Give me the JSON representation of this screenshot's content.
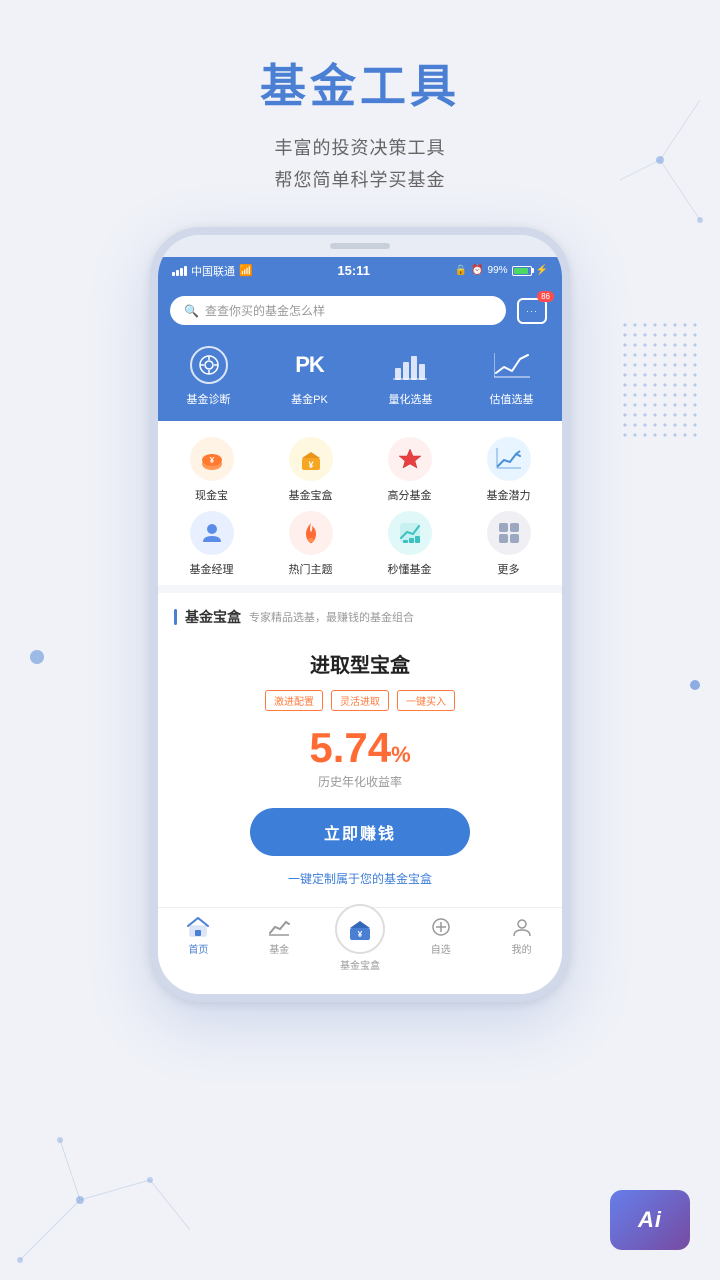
{
  "page": {
    "title": "基金工具",
    "subtitle_line1": "丰富的投资决策工具",
    "subtitle_line2": "帮您简单科学买基金"
  },
  "status_bar": {
    "carrier": "中国联通",
    "time": "15:11",
    "battery": "99%"
  },
  "search": {
    "placeholder": "查查你买的基金怎么样",
    "message_badge": "86"
  },
  "tools": [
    {
      "label": "基金诊断",
      "icon_type": "brain"
    },
    {
      "label": "基金PK",
      "icon_type": "pk"
    },
    {
      "label": "量化选基",
      "icon_type": "bar"
    },
    {
      "label": "估值选基",
      "icon_type": "trend"
    }
  ],
  "menu_items": [
    {
      "label": "现金宝",
      "icon": "🐷",
      "color_class": "icon-orange"
    },
    {
      "label": "基金宝盒",
      "icon": "💰",
      "color_class": "icon-gold"
    },
    {
      "label": "高分基金",
      "icon": "⭐",
      "color_class": "icon-red"
    },
    {
      "label": "基金潜力",
      "icon": "📈",
      "color_class": "icon-blue-light"
    },
    {
      "label": "基金经理",
      "icon": "👤",
      "color_class": "icon-blue"
    },
    {
      "label": "热门主题",
      "icon": "🔥",
      "color_class": "icon-red2"
    },
    {
      "label": "秒懂基金",
      "icon": "📊",
      "color_class": "icon-cyan"
    },
    {
      "label": "更多",
      "icon": "⋯",
      "color_class": "icon-gray"
    }
  ],
  "fund_box": {
    "section_title": "基金宝盒",
    "section_desc": "专家精品选基，最赚钱的基金组合",
    "card_title": "进取型宝盒",
    "tags": [
      "激进配置",
      "灵活进取",
      "一键买入"
    ],
    "rate": "5.74",
    "rate_unit": "%",
    "rate_label": "历史年化收益率",
    "button_label": "立即赚钱",
    "custom_link": "一键定制属于您的基金宝盒"
  },
  "bottom_nav": [
    {
      "label": "首页",
      "active": true,
      "icon_type": "home"
    },
    {
      "label": "基金",
      "active": false,
      "icon_type": "chart"
    },
    {
      "label": "基金宝盒",
      "active": false,
      "icon_type": "box",
      "center": true
    },
    {
      "label": "自选",
      "active": false,
      "icon_type": "plus"
    },
    {
      "label": "我的",
      "active": false,
      "icon_type": "user"
    }
  ],
  "ai_badge": {
    "text": "Ai"
  }
}
